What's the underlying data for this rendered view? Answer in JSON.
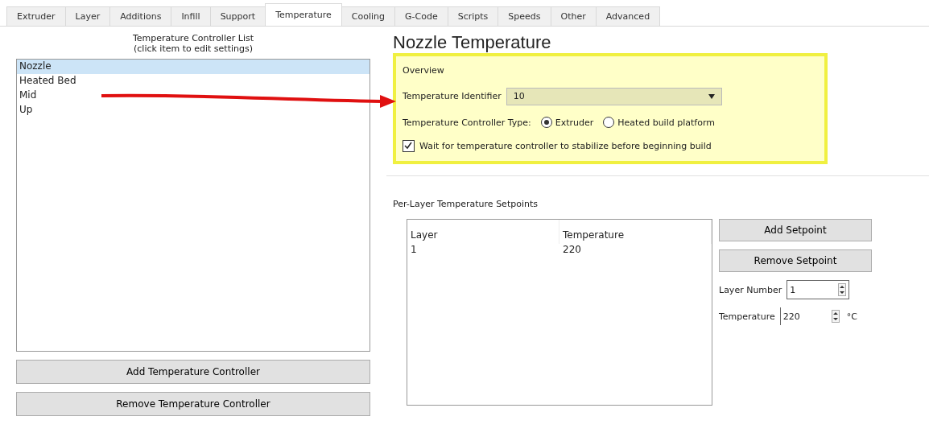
{
  "tabs": [
    {
      "label": "Extruder",
      "selected": false
    },
    {
      "label": "Layer",
      "selected": false
    },
    {
      "label": "Additions",
      "selected": false
    },
    {
      "label": "Infill",
      "selected": false
    },
    {
      "label": "Support",
      "selected": false
    },
    {
      "label": "Temperature",
      "selected": true
    },
    {
      "label": "Cooling",
      "selected": false
    },
    {
      "label": "G-Code",
      "selected": false
    },
    {
      "label": "Scripts",
      "selected": false
    },
    {
      "label": "Speeds",
      "selected": false
    },
    {
      "label": "Other",
      "selected": false
    },
    {
      "label": "Advanced",
      "selected": false
    }
  ],
  "controller_list": {
    "title": "Temperature Controller List",
    "hint": "(click item to edit settings)",
    "items": [
      {
        "label": "Nozzle",
        "selected": true
      },
      {
        "label": "Heated Bed",
        "selected": false
      },
      {
        "label": "Mid",
        "selected": false
      },
      {
        "label": "Up",
        "selected": false
      }
    ],
    "buttons": [
      "Add Temperature Controller",
      "Remove Temperature Controller"
    ]
  },
  "heading": "Nozzle Temperature",
  "overview": {
    "title": "Overview",
    "identifier_label": "Temperature Identifier",
    "identifier_value": "10",
    "type_label": "Temperature Controller Type:",
    "types": [
      {
        "label": "Extruder",
        "selected": true
      },
      {
        "label": "Heated build platform",
        "selected": false
      }
    ],
    "wait": {
      "label": "Wait for temperature controller to stabilize before beginning build",
      "checked": true
    }
  },
  "setpoints": {
    "title": "Per-Layer Temperature Setpoints",
    "columns": [
      "Layer",
      "Temperature"
    ],
    "rows": [
      [
        "1",
        "220"
      ]
    ],
    "buttons": [
      "Add Setpoint",
      "Remove Setpoint"
    ],
    "layer_label": "Layer Number",
    "layer_value": "1",
    "temp_label": "Temperature",
    "temp_value": "220",
    "temp_unit": "°C"
  }
}
